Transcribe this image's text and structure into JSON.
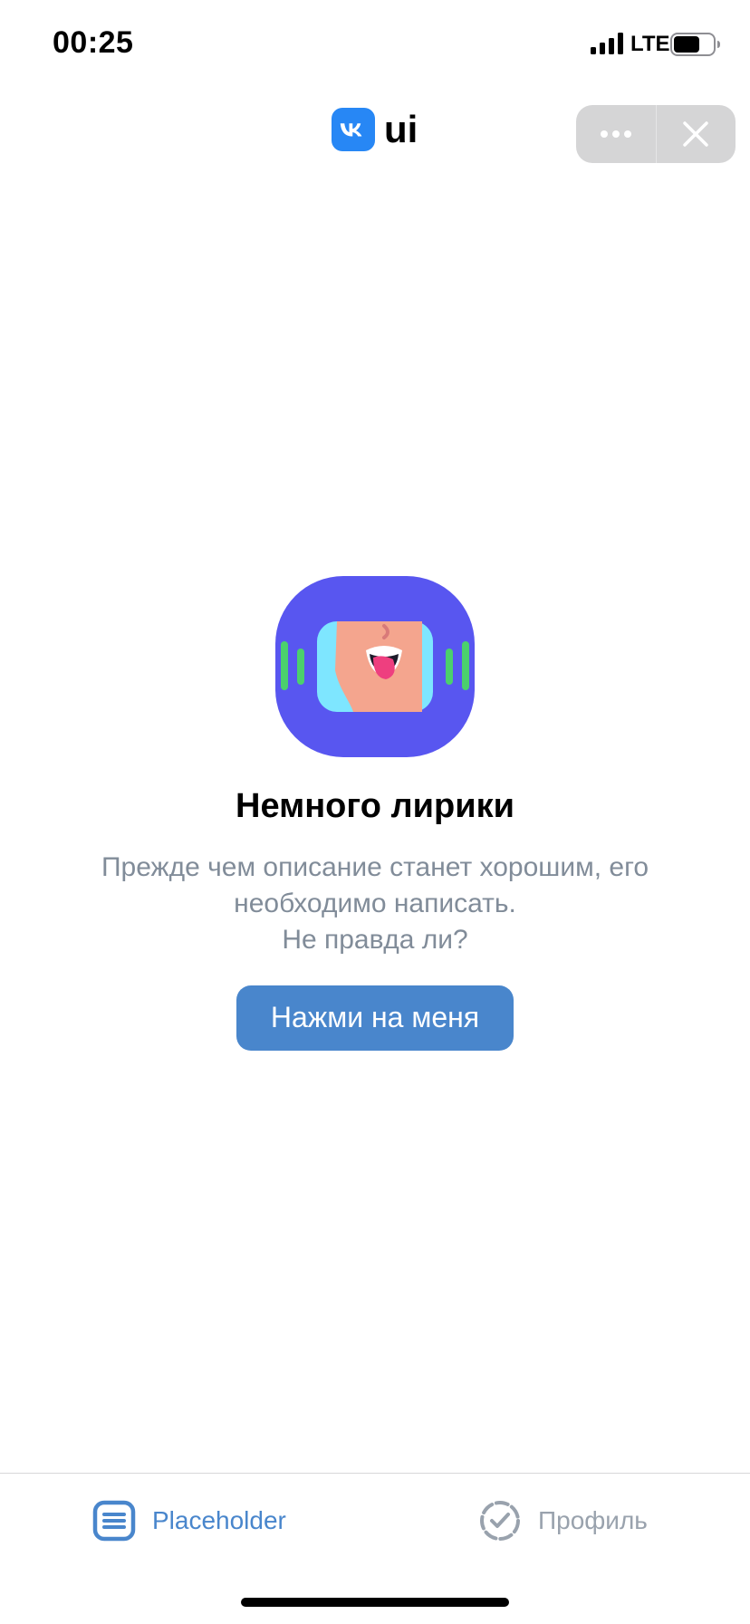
{
  "status_bar": {
    "time": "00:25",
    "network": "LTE",
    "signal_icon": "cellular-signal-icon",
    "battery_icon": "battery-icon"
  },
  "header": {
    "logo_icon": "vk-logo-icon",
    "logo_text": "ui"
  },
  "mini_app_controls": {
    "more_icon": "more-horizontal-icon",
    "close_icon": "close-icon"
  },
  "placeholder": {
    "illustration_icon": "mini-app-illustration-icon",
    "title": "Немного лирики",
    "description_lines": [
      "Прежде чем описание станет хорошим, его",
      "необходимо написать.",
      "Не правда ли?"
    ],
    "button_label": "Нажми на меня"
  },
  "tabbar": {
    "tabs": [
      {
        "label": "Placeholder",
        "icon": "list-icon",
        "active": true
      },
      {
        "label": "Профиль",
        "icon": "check-circle-outline-icon",
        "active": false
      }
    ]
  },
  "colors": {
    "accent": "#4986cc",
    "vk_blue": "#2787f5",
    "secondary_text": "#818c99",
    "inactive_tab": "#99a2ad",
    "illustration_bg": "#5856f0",
    "illustration_green": "#4bd06d",
    "illustration_cyan": "#7ee6ff"
  }
}
